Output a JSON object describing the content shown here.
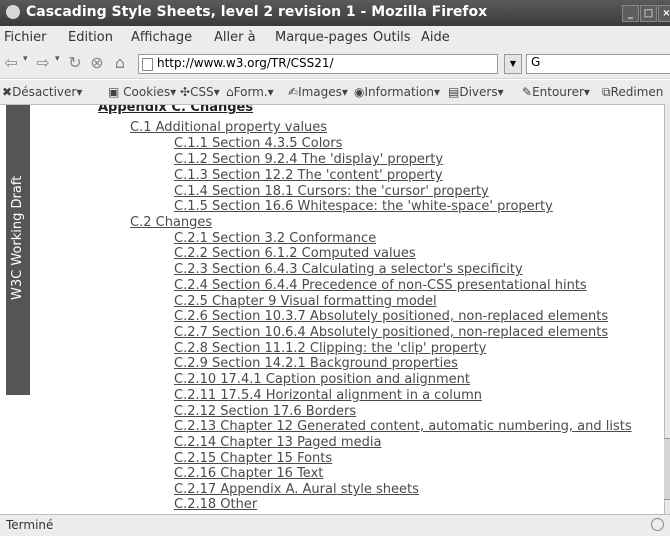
{
  "window": {
    "title": "Cascading Style Sheets, level 2 revision 1 - Mozilla Firefox"
  },
  "menubar": [
    "Fichier",
    "Edition",
    "Affichage",
    "Aller à",
    "Marque-pages",
    "Outils",
    "Aide"
  ],
  "navbar": {
    "url": "http://www.w3.org/TR/CSS21/",
    "search_value": ""
  },
  "devbar": [
    "Désactiver",
    "Cookies",
    "CSS",
    "Form.",
    "Images",
    "Information",
    "Divers",
    "Entourer",
    "Redimen"
  ],
  "page": {
    "sidebar_tag": "W3C Working Draft",
    "toc": [
      {
        "text": "Appendix C. Changes",
        "level": 0
      },
      {
        "text": "C.1 Additional property values",
        "level": 1
      },
      {
        "text": "C.1.1 Section 4.3.5 Colors",
        "level": 2
      },
      {
        "text": "C.1.2 Section 9.2.4 The 'display' property",
        "level": 2
      },
      {
        "text": "C.1.3 Section 12.2 The 'content' property",
        "level": 2
      },
      {
        "text": "C.1.4 Section 18.1 Cursors: the 'cursor' property",
        "level": 2
      },
      {
        "text": "C.1.5 Section 16.6 Whitespace: the 'white-space' property",
        "level": 2
      },
      {
        "text": "C.2 Changes",
        "level": 1
      },
      {
        "text": "C.2.1 Section 3.2 Conformance",
        "level": 2
      },
      {
        "text": "C.2.2 Section 6.1.2 Computed values",
        "level": 2
      },
      {
        "text": "C.2.3 Section 6.4.3 Calculating a selector's specificity",
        "level": 2
      },
      {
        "text": "C.2.4 Section 6.4.4 Precedence of non-CSS presentational hints",
        "level": 2
      },
      {
        "text": "C.2.5 Chapter 9 Visual formatting model",
        "level": 2
      },
      {
        "text": "C.2.6 Section 10.3.7 Absolutely positioned, non-replaced elements",
        "level": 2
      },
      {
        "text": "C.2.7 Section 10.6.4 Absolutely positioned, non-replaced elements",
        "level": 2
      },
      {
        "text": "C.2.8 Section 11.1.2 Clipping: the 'clip' property",
        "level": 2
      },
      {
        "text": "C.2.9 Section 14.2.1 Background properties",
        "level": 2
      },
      {
        "text": "C.2.10 17.4.1 Caption position and alignment",
        "level": 2
      },
      {
        "text": "C.2.11 17.5.4 Horizontal alignment in a column",
        "level": 2
      },
      {
        "text": "C.2.12 Section 17.6 Borders",
        "level": 2
      },
      {
        "text": "C.2.13 Chapter 12 Generated content, automatic numbering, and lists",
        "level": 2
      },
      {
        "text": "C.2.14 Chapter 13 Paged media",
        "level": 2
      },
      {
        "text": "C.2.15 Chapter 15 Fonts",
        "level": 2
      },
      {
        "text": "C.2.16 Chapter 16 Text",
        "level": 2
      },
      {
        "text": "C.2.17 Appendix A. Aural style sheets",
        "level": 2
      },
      {
        "text": "C.2.18 Other",
        "level": 2
      }
    ]
  },
  "status": {
    "text": "Terminé"
  }
}
